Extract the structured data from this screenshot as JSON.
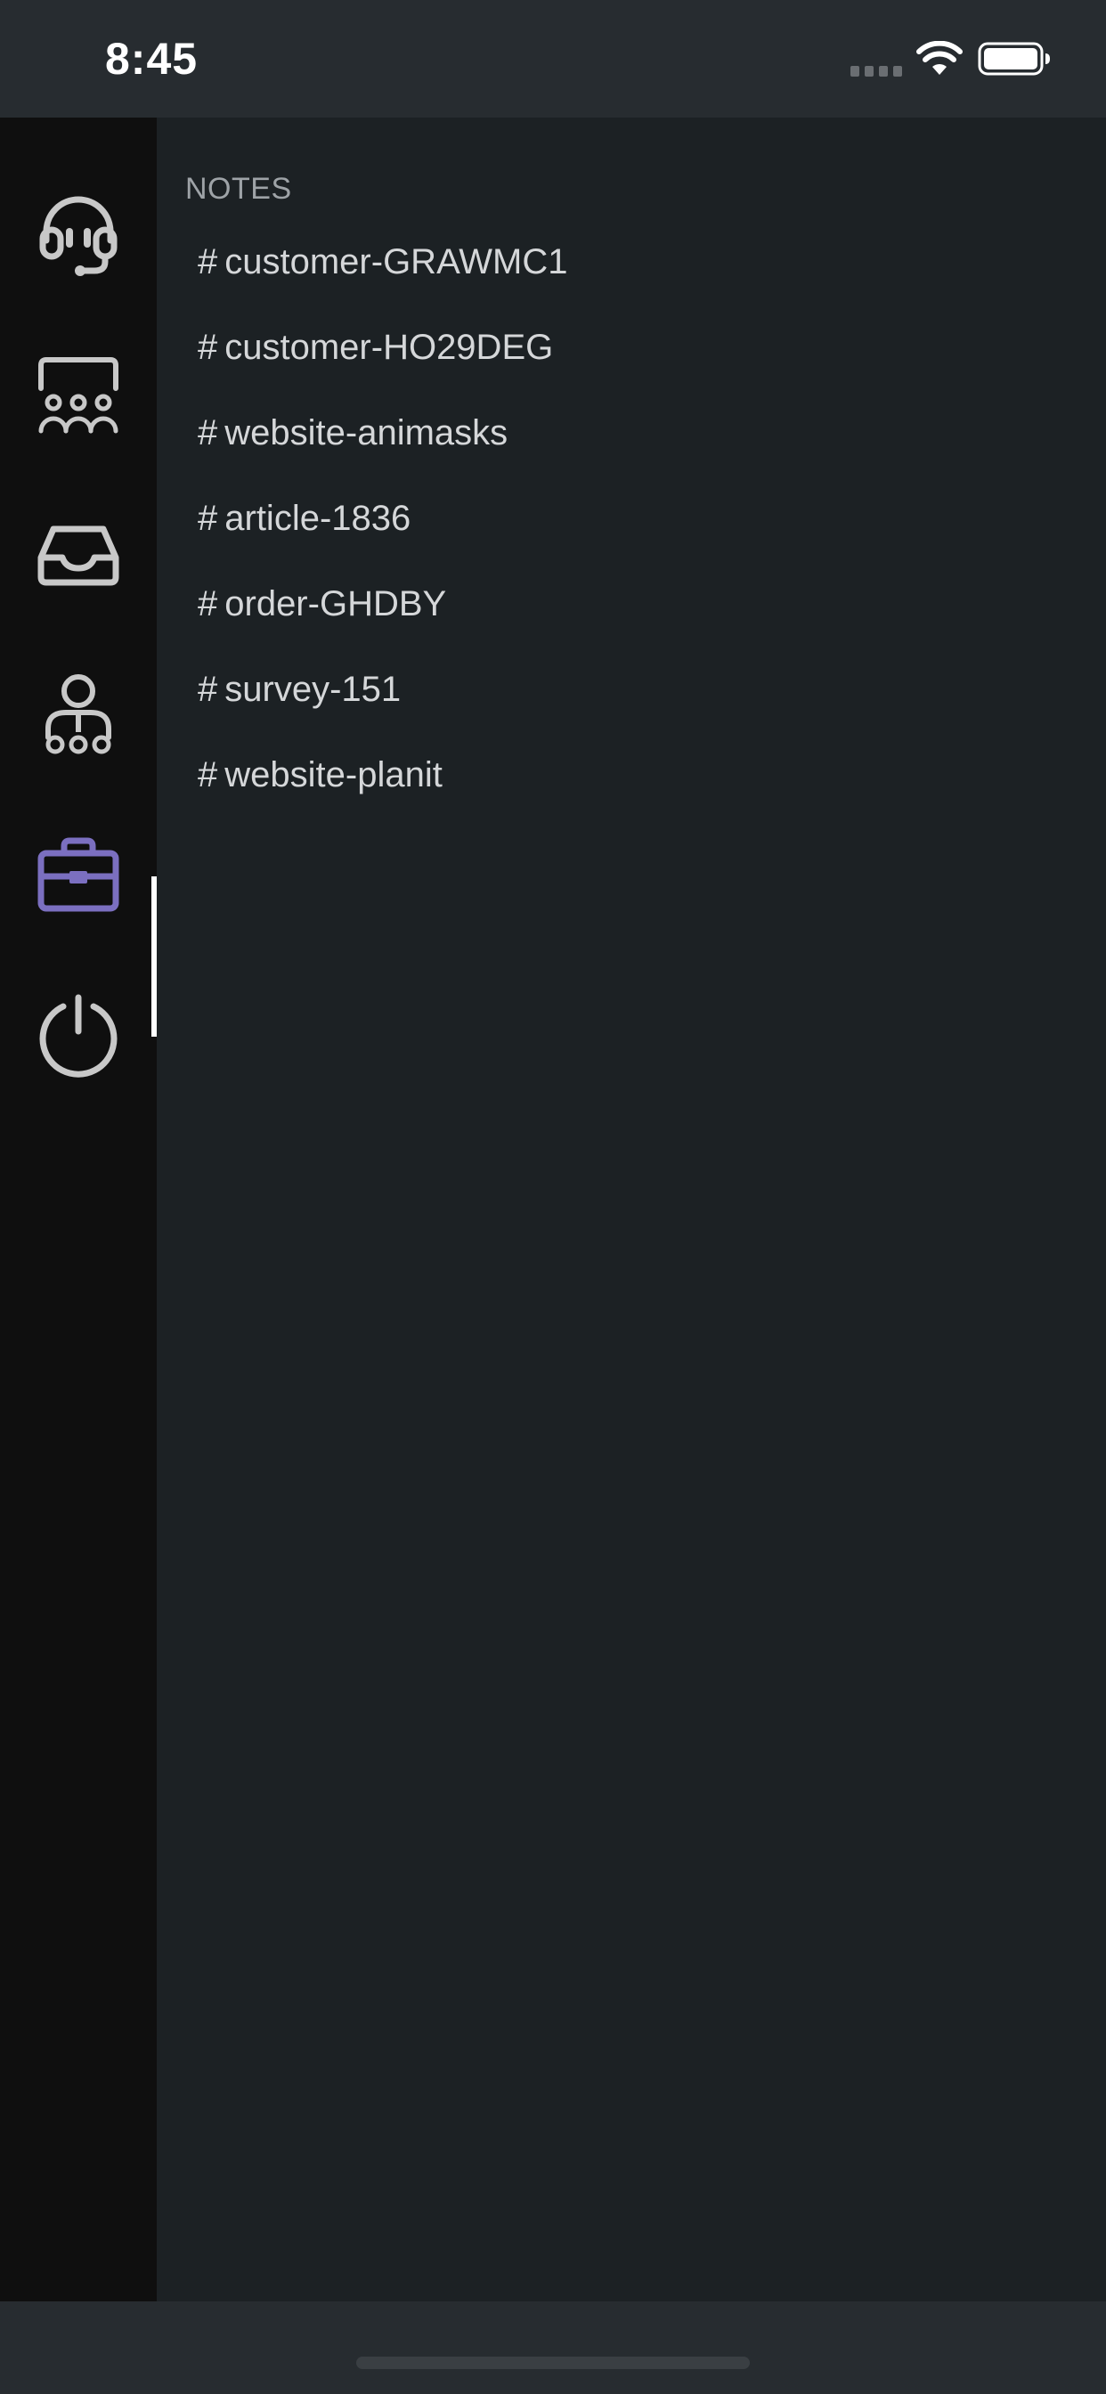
{
  "status_bar": {
    "time": "8:45"
  },
  "rail": {
    "items": [
      {
        "icon": "headset-icon",
        "active": false
      },
      {
        "icon": "team-icon",
        "active": false
      },
      {
        "icon": "inbox-icon",
        "active": false
      },
      {
        "icon": "user-network-icon",
        "active": false
      },
      {
        "icon": "briefcase-icon",
        "active": true
      },
      {
        "icon": "power-icon",
        "active": false
      }
    ],
    "icon_color": "#c8c8c8",
    "active_icon_color": "#7b6fc0"
  },
  "notes": {
    "heading": "NOTES",
    "hash": "#",
    "items": [
      {
        "label": "customer-GRAWMC1"
      },
      {
        "label": "customer-HO29DEG"
      },
      {
        "label": "website-animasks"
      },
      {
        "label": "article-1836"
      },
      {
        "label": "order-GHDBY"
      },
      {
        "label": "survey-151"
      },
      {
        "label": "website-planit"
      }
    ]
  }
}
